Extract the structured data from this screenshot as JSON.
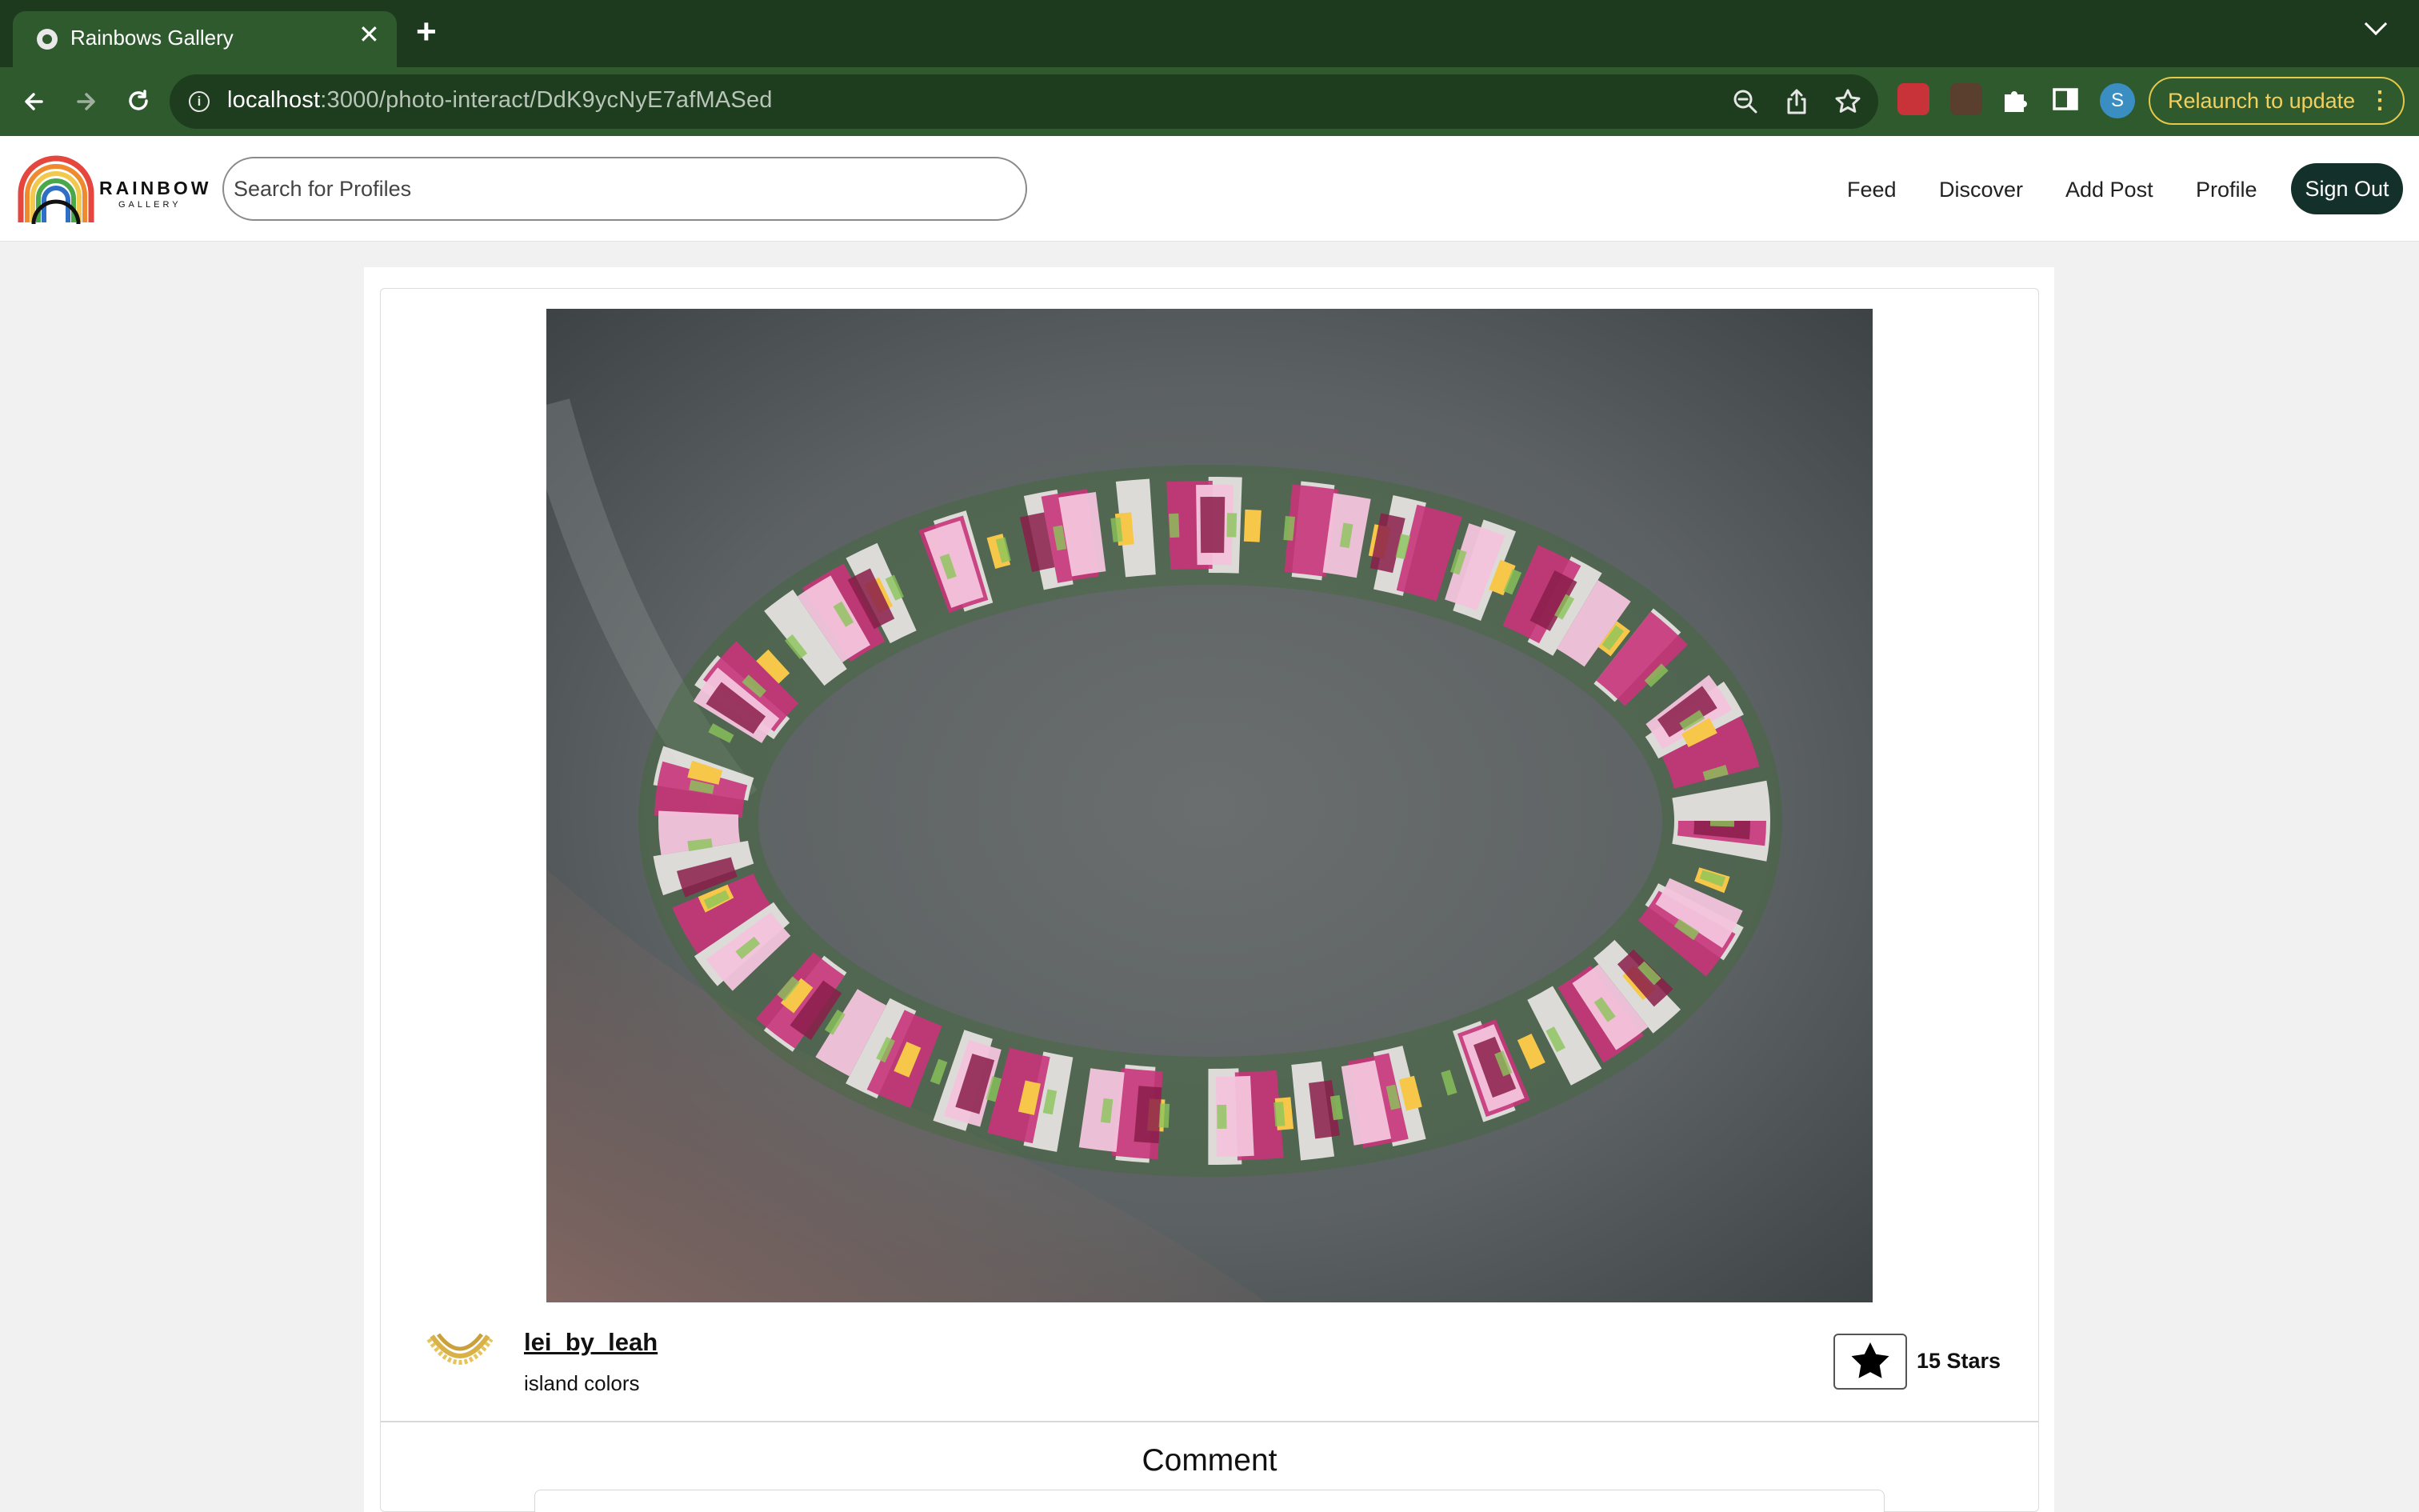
{
  "browser": {
    "tab_title": "Rainbows Gallery",
    "tab_close": "✕",
    "new_tab": "+",
    "url_host": "localhost",
    "url_path": ":3000/photo-interact/DdK9ycNyE7afMASed",
    "profile_initial": "S",
    "relaunch_label": "Relaunch to update"
  },
  "header": {
    "logo_text": "RAINBOW",
    "logo_subtext": "GALLERY",
    "search_placeholder": "Search for Profiles",
    "nav": [
      "Feed",
      "Discover",
      "Add Post",
      "Profile"
    ],
    "signout_label": "Sign Out"
  },
  "post": {
    "username": "lei_by_leah",
    "caption": "island colors",
    "stars": "15 Stars"
  },
  "comments": {
    "title": "Comment"
  },
  "colors": {
    "chrome_dark": "#1e3a1e",
    "chrome_toolbar": "#2e5a2e",
    "signout_bg": "#13302a",
    "relaunch_accent": "#f2d060"
  }
}
